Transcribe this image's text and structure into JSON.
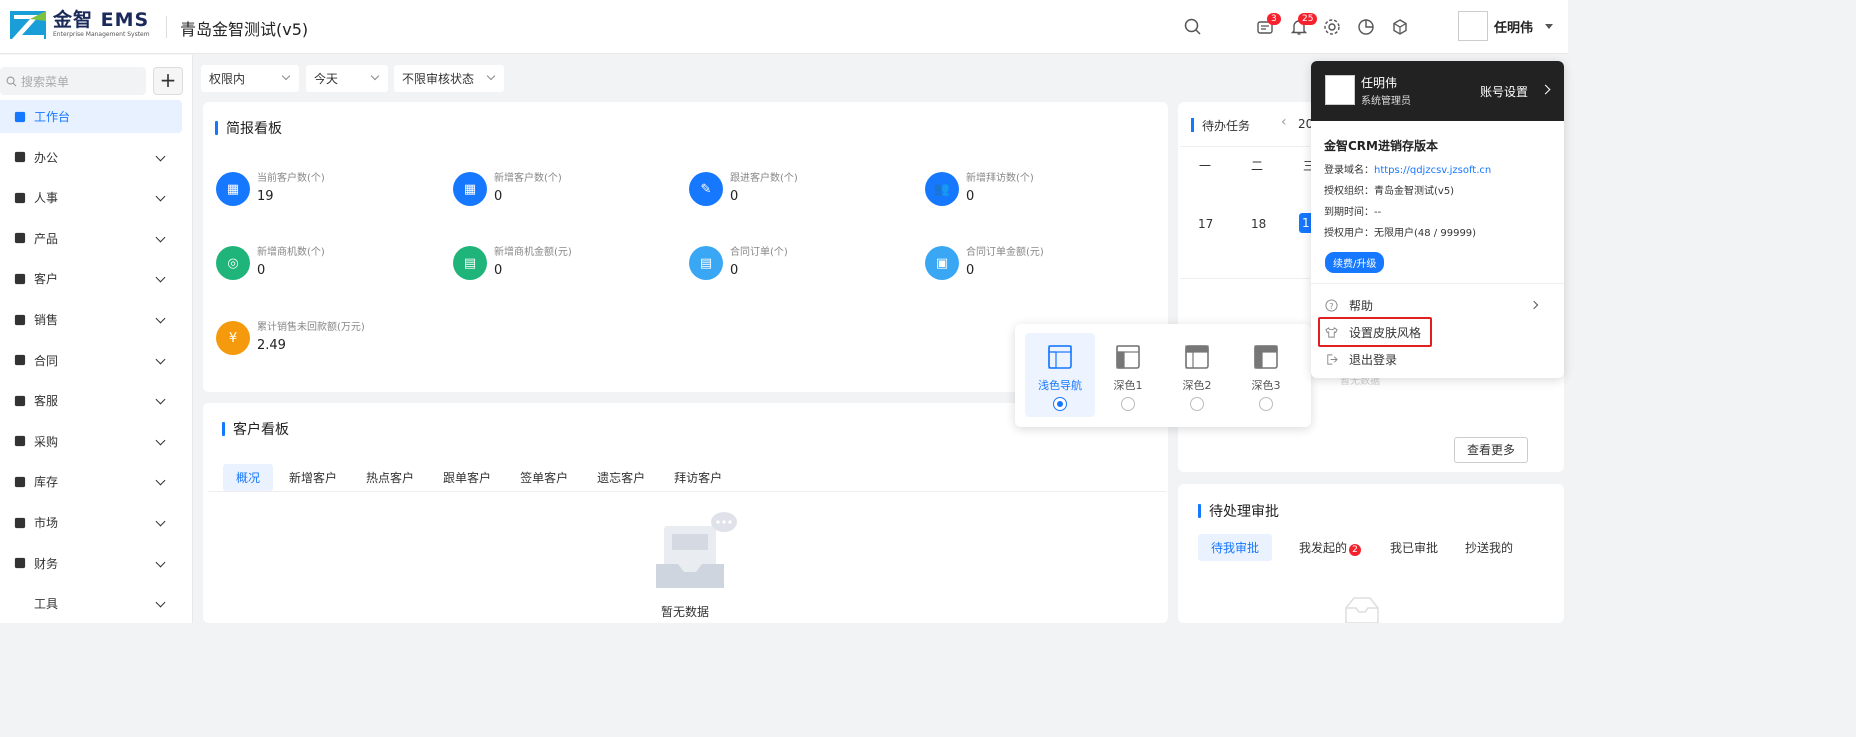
{
  "header": {
    "logo_title": "金智 EMS",
    "logo_sub": "Enterprise Management System",
    "app_title": "青岛金智测试(v5)",
    "badge_messages": "3",
    "badge_notifications": "25",
    "user_name": "任明伟"
  },
  "sidebar": {
    "search_placeholder": "搜索菜单",
    "add_label": "+",
    "items": [
      {
        "label": "工作台",
        "icon": "dashboard-icon"
      },
      {
        "label": "办公",
        "icon": "office-icon"
      },
      {
        "label": "人事",
        "icon": "hr-icon"
      },
      {
        "label": "产品",
        "icon": "product-icon"
      },
      {
        "label": "客户",
        "icon": "customer-icon"
      },
      {
        "label": "销售",
        "icon": "sales-icon"
      },
      {
        "label": "合同",
        "icon": "contract-icon"
      },
      {
        "label": "客服",
        "icon": "headset-icon"
      },
      {
        "label": "采购",
        "icon": "purchase-icon"
      },
      {
        "label": "库存",
        "icon": "inventory-icon"
      },
      {
        "label": "市场",
        "icon": "market-icon"
      },
      {
        "label": "财务",
        "icon": "finance-icon"
      },
      {
        "label": "工具",
        "icon": "tools-icon"
      }
    ]
  },
  "filters": {
    "scope": "权限内",
    "date": "今天",
    "audit": "不限审核状态"
  },
  "brief": {
    "title": "简报看板",
    "stats": [
      {
        "label": "当前客户数(个)",
        "value": "19",
        "color": "#1677ff"
      },
      {
        "label": "新增客户数(个)",
        "value": "0",
        "color": "#1677ff"
      },
      {
        "label": "跟进客户数(个)",
        "value": "0",
        "color": "#1677ff"
      },
      {
        "label": "新增拜访数(个)",
        "value": "0",
        "color": "#1677ff"
      },
      {
        "label": "新增商机数(个)",
        "value": "0",
        "color": "#1fb57a"
      },
      {
        "label": "新增商机金额(元)",
        "value": "0",
        "color": "#1fb57a"
      },
      {
        "label": "合同订单(个)",
        "value": "0",
        "color": "#3aa7f5"
      },
      {
        "label": "合同订单金额(元)",
        "value": "0",
        "color": "#3aa7f5"
      },
      {
        "label": "累计销售未回款额(万元)",
        "value": "2.49",
        "color": "#f59a0c"
      }
    ]
  },
  "customer_board": {
    "title": "客户看板",
    "tabs": [
      "概况",
      "新增客户",
      "热点客户",
      "跟单客户",
      "签单客户",
      "遗忘客户",
      "拜访客户"
    ],
    "empty_text": "暂无数据"
  },
  "todo": {
    "title": "待办任务",
    "year_partial": "20",
    "weekdays": [
      "一",
      "二",
      "三"
    ],
    "days": [
      "17",
      "18",
      "1"
    ],
    "more_button": "查看更多",
    "empty_partial": "暂无数据"
  },
  "approval": {
    "title": "待处理审批",
    "tabs": [
      "待我审批",
      "我发起的",
      "我已审批",
      "抄送我的"
    ],
    "initiated_badge": "2"
  },
  "skin_popup": {
    "options": [
      {
        "label": "浅色导航",
        "selected": true
      },
      {
        "label": "深色1",
        "selected": false
      },
      {
        "label": "深色2",
        "selected": false
      },
      {
        "label": "深色3",
        "selected": false
      }
    ]
  },
  "user_popup": {
    "name": "任明伟",
    "role": "系统管理员",
    "account_settings": "账号设置",
    "version": "金智CRM进销存版本",
    "domain_label": "登录域名：",
    "domain": "https://qdjzcsv.jzsoft.cn",
    "org_label": "授权组织：",
    "org": "青岛金智测试(v5)",
    "expire_label": "到期时间：",
    "expire": "--",
    "users_label": "授权用户：",
    "users": "无限用户(48 / 99999)",
    "renew_button": "续费/升级",
    "help": "帮助",
    "skin": "设置皮肤风格",
    "logout": "退出登录"
  }
}
